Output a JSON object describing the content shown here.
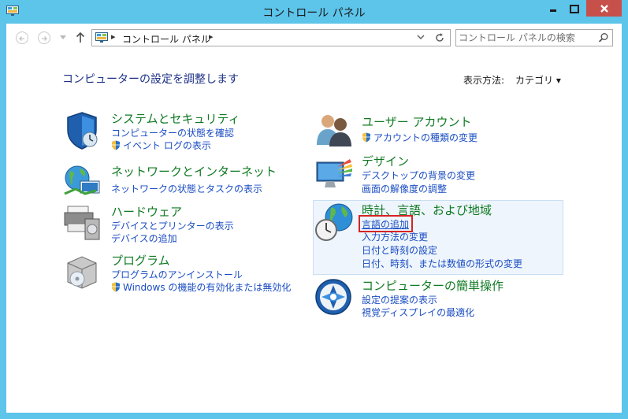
{
  "window": {
    "title": "コントロール パネル",
    "minimize_glyph": "▬",
    "maximize_glyph": "□",
    "close_glyph": "✕"
  },
  "nav": {
    "back_glyph": "←",
    "forward_glyph": "→",
    "recent_glyph": "▾",
    "up_glyph": "↑",
    "breadcrumb_sep": "▸",
    "breadcrumb": "コントロール パネル",
    "breadcrumb_sep2": "▸",
    "dropdown_glyph": "⌄",
    "refresh_glyph": "↻",
    "search_placeholder": "コントロール パネルの検索",
    "search_icon_glyph": "⚲"
  },
  "page": {
    "heading": "コンピューターの設定を調整します",
    "view_by_label": "表示方法:",
    "view_by_value": "カテゴリ ▾"
  },
  "left_categories": [
    {
      "title": "システムとセキュリティ",
      "links": [
        {
          "text": "コンピューターの状態を確認",
          "shield": false
        },
        {
          "text": "イベント ログの表示",
          "shield": true
        }
      ]
    },
    {
      "title": "ネットワークとインターネット",
      "links": [
        {
          "text": "ネットワークの状態とタスクの表示",
          "shield": false
        }
      ]
    },
    {
      "title": "ハードウェア",
      "links": [
        {
          "text": "デバイスとプリンターの表示",
          "shield": false
        },
        {
          "text": "デバイスの追加",
          "shield": false
        }
      ]
    },
    {
      "title": "プログラム",
      "links": [
        {
          "text": "プログラムのアンインストール",
          "shield": false
        },
        {
          "text": "Windows の機能の有効化または無効化",
          "shield": true
        }
      ]
    }
  ],
  "right_categories": [
    {
      "title": "ユーザー アカウント",
      "links": [
        {
          "text": "アカウントの種類の変更",
          "shield": true
        }
      ]
    },
    {
      "title": "デザイン",
      "links": [
        {
          "text": "デスクトップの背景の変更",
          "shield": false
        },
        {
          "text": "画面の解像度の調整",
          "shield": false
        }
      ]
    },
    {
      "title": "時計、言語、および地域",
      "links": [
        {
          "text": "言語の追加",
          "shield": false
        },
        {
          "text": "入力方法の変更",
          "shield": false
        },
        {
          "text": "日付と時刻の設定",
          "shield": false
        },
        {
          "text": "日付、時刻、または数値の形式の変更",
          "shield": false
        }
      ]
    },
    {
      "title": "コンピューターの簡単操作",
      "links": [
        {
          "text": "設定の提案の表示",
          "shield": false
        },
        {
          "text": "視覚ディスプレイの最適化",
          "shield": false
        }
      ]
    }
  ],
  "colors": {
    "frame": "#5dc4ea",
    "category_title": "#0f7a22",
    "link": "#1a4cc3",
    "heading": "#1e3287",
    "highlight_border": "#d62424"
  }
}
